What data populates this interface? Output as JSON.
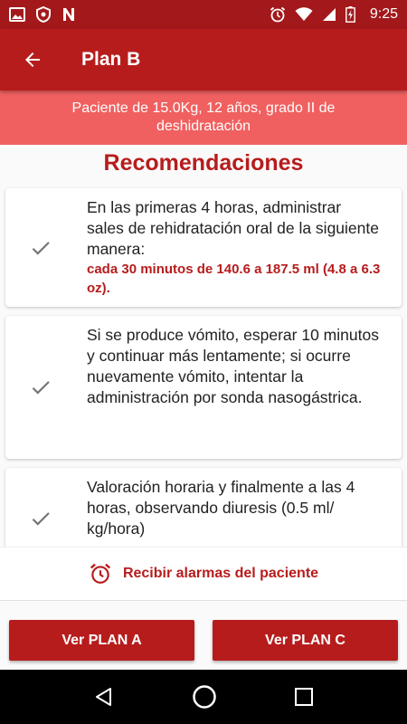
{
  "status_bar": {
    "time": "9:25",
    "left_icons": [
      "image-icon",
      "shield-icon",
      "n-app-icon"
    ],
    "right_icons": [
      "alarm-icon",
      "wifi-icon",
      "signal-icon",
      "battery-charging-icon"
    ]
  },
  "app_bar": {
    "back_icon": "arrow-back-icon",
    "title": "Plan B"
  },
  "patient_banner": "Paciente de 15.0Kg, 12 años, grado II de deshidratación",
  "section_title": "Recomendaciones",
  "recommendations": [
    {
      "text": "En las primeras 4 horas, administrar sales de rehidratación oral de la siguiente manera:",
      "highlight": "cada 30 minutos de 140.6 a 187.5 ml (4.8 a 6.3 oz)."
    },
    {
      "text": "Si se produce vómito, esperar 10 minutos y continuar más lentamente; si ocurre nuevamente vómito, intentar la administración por sonda nasogástrica."
    },
    {
      "text": "Valoración horaria y finalmente a las 4 horas, observando diuresis (0.5 ml/ kg/hora)"
    }
  ],
  "alarm": {
    "icon": "alarm-clock-icon",
    "label": "Recibir alarmas del paciente"
  },
  "buttons": {
    "plan_a": "Ver PLAN A",
    "plan_c": "Ver PLAN C"
  },
  "colors": {
    "primary": "#b71c1c",
    "status_bar": "#a3191b",
    "banner": "#f06060"
  }
}
